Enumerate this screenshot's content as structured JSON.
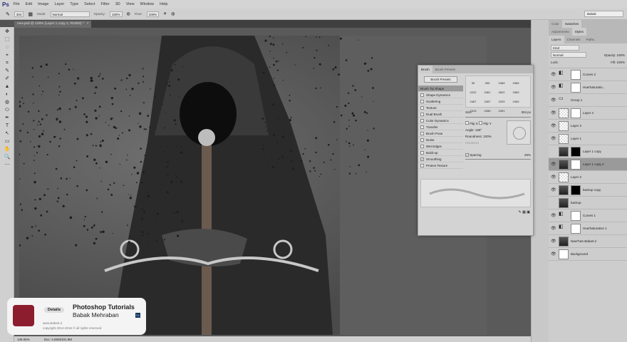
{
  "menu": {
    "logo": "Ps",
    "items": [
      "File",
      "Edit",
      "Image",
      "Layer",
      "Type",
      "Select",
      "Filter",
      "3D",
      "View",
      "Window",
      "Help"
    ]
  },
  "options": {
    "brush_size": "304",
    "mode_label": "Mode:",
    "mode": "Normal",
    "opacity_label": "Opacity:",
    "opacity": "100%",
    "flow_label": "Flow:",
    "flow": "100%"
  },
  "search": "Babak",
  "document": {
    "tab": "new.psd @ 139% (Layer 1 copy 2, RGB/8) *",
    "close": "×",
    "zoom": "139.05%",
    "doc_size": "Doc: 4.65M/101.9M"
  },
  "tools": [
    "✥",
    "⬚",
    "◌",
    "⌖",
    "⌗",
    "✎",
    "✐",
    "▲",
    "◐",
    "◍",
    "⬭",
    "✒",
    "T",
    "↖",
    "▭",
    "✋",
    "🔍",
    "⋯"
  ],
  "brush_panel": {
    "tabs": [
      "Brush",
      "Brush Presets"
    ],
    "presets_button": "Brush Presets",
    "options": [
      {
        "label": "Brush Tip Shape",
        "checked": null
      },
      {
        "label": "Shape Dynamics",
        "checked": false
      },
      {
        "label": "Scattering",
        "checked": false
      },
      {
        "label": "Texture",
        "checked": false
      },
      {
        "label": "Dual Brush",
        "checked": false
      },
      {
        "label": "Color Dynamics",
        "checked": false
      },
      {
        "label": "Transfer",
        "checked": false
      },
      {
        "label": "Brush Pose",
        "checked": false
      },
      {
        "label": "Noise",
        "checked": false
      },
      {
        "label": "Wet Edges",
        "checked": false
      },
      {
        "label": "Build-up",
        "checked": false
      },
      {
        "label": "Smoothing",
        "checked": true
      },
      {
        "label": "Protect Texture",
        "checked": false
      }
    ],
    "tips": [
      "30",
      "300",
      "2469",
      "2469",
      "2222",
      "2461",
      "2622",
      "1853",
      "2467",
      "2457",
      "2229",
      "2400",
      "2413",
      "2289",
      "2491"
    ],
    "size_label": "Size",
    "size": "304 px",
    "flip_x": "Flip X",
    "flip_y": "Flip Y",
    "angle_label": "Angle:",
    "angle": "168°",
    "roundness_label": "Roundness:",
    "roundness": "100%",
    "hardness_label": "Hardness",
    "spacing_label": "Spacing",
    "spacing": "25%"
  },
  "panels": {
    "top_tabs": [
      "Color",
      "Swatches"
    ],
    "mid_tabs": [
      "Adjustments",
      "Styles"
    ],
    "layer_tabs": [
      "Layers",
      "Channels",
      "Paths"
    ],
    "kind": "Kind",
    "blend": "Normal",
    "opacity_label": "Opacity:",
    "opacity": "100%",
    "lock_label": "Lock:",
    "fill_label": "Fill:",
    "fill": "100%"
  },
  "layers": [
    {
      "name": "Curves 2",
      "thumb": "adj",
      "mask": "white",
      "eye": true
    },
    {
      "name": "Hue/Saturatio...",
      "thumb": "adj",
      "mask": "white",
      "eye": true
    },
    {
      "name": "Group 1",
      "thumb": "folder",
      "mask": null,
      "eye": true
    },
    {
      "name": "Layer 4",
      "thumb": "trans",
      "mask": "white",
      "eye": true
    },
    {
      "name": "Layer 3",
      "thumb": "trans",
      "mask": null,
      "eye": true
    },
    {
      "name": "Layer 1",
      "thumb": "trans",
      "mask": null,
      "eye": true
    },
    {
      "name": "Layer 1 copy",
      "thumb": "photo",
      "mask": "black",
      "eye": false
    },
    {
      "name": "Layer 1 copy 2",
      "thumb": "photo",
      "mask": "white",
      "eye": true,
      "selected": true
    },
    {
      "name": "Layer 2",
      "thumb": "trans",
      "mask": null,
      "eye": true
    },
    {
      "name": "backup copy",
      "thumb": "photo",
      "mask": "black",
      "eye": true
    },
    {
      "name": "backup",
      "thumb": "photo",
      "mask": null,
      "eye": false
    },
    {
      "name": "Curves 1",
      "thumb": "adj",
      "mask": "white",
      "eye": true
    },
    {
      "name": "Hue/Saturation 1",
      "thumb": "adj",
      "mask": "white",
      "eye": true
    },
    {
      "name": "NawTute-Babart.ir",
      "thumb": "photo",
      "mask": null,
      "eye": true
    },
    {
      "name": "Background",
      "thumb": "white",
      "mask": null,
      "eye": true
    }
  ],
  "watermark": {
    "details": "Details",
    "title": "Photoshop Tutorials",
    "author": "Babak Mehraban",
    "url": "www.babart.ir",
    "copyright": "copyright 2014-2016 © all rights reserved",
    "badge": "Ps"
  }
}
